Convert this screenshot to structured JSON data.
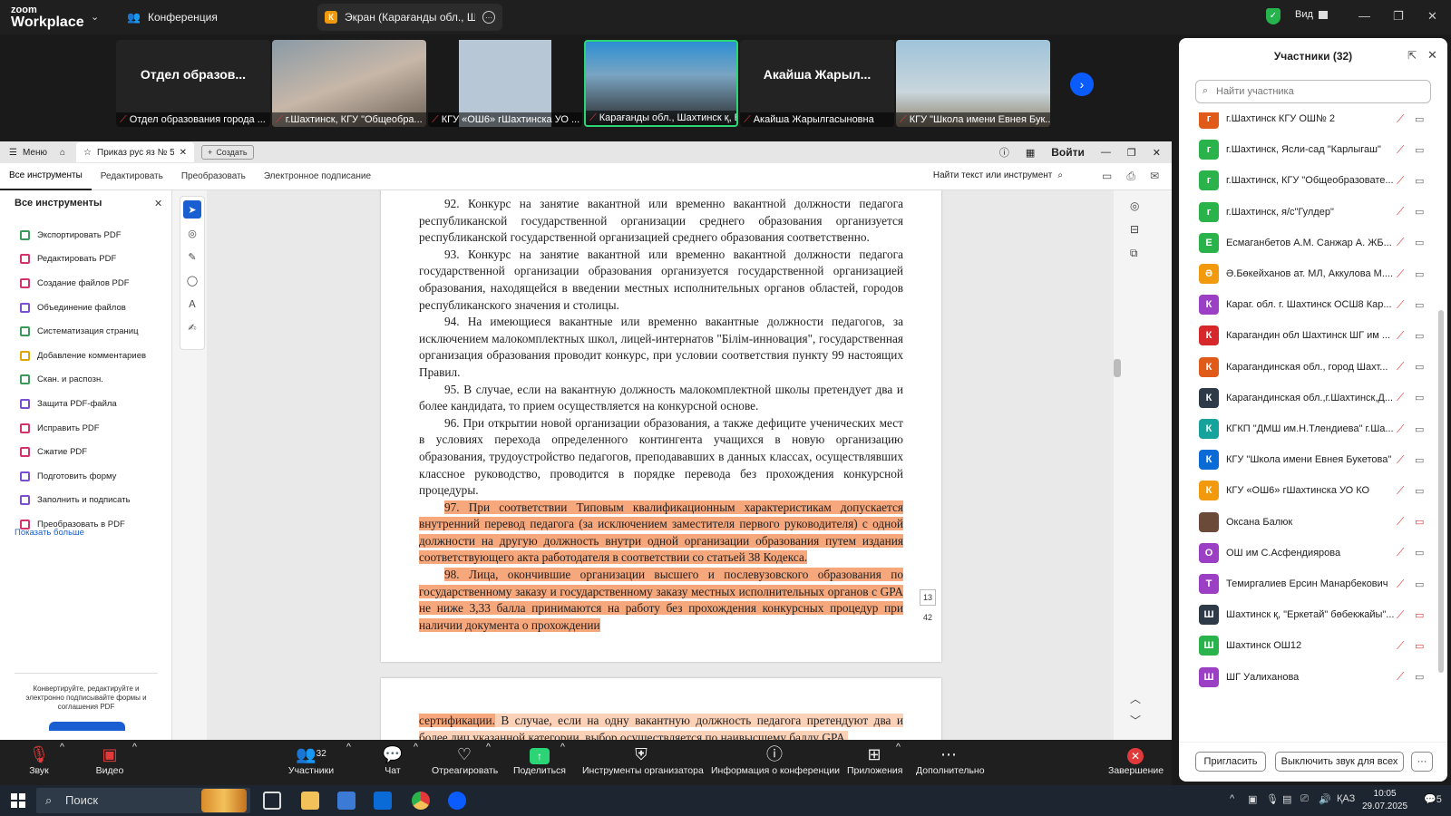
{
  "app": {
    "logo_line1": "zoom",
    "logo_line2": "Workplace",
    "tab_conference": "Конференция",
    "tab_screen": "Экран (Карағанды обл., Шахтин",
    "view_label": "Вид",
    "colors": {
      "accent": "#0b5cff",
      "green": "#2bd576",
      "red": "#e23a3a",
      "highlight": "#f6a77c"
    }
  },
  "video_tiles": [
    {
      "big": "Отдел образов...",
      "name": "Отдел образования города ..."
    },
    {
      "big": "",
      "name": "г.Шахтинск, КГУ \"Общеобра..."
    },
    {
      "big": "",
      "name": "КГУ «ОШ6» гШахтинска УО ..."
    },
    {
      "big": "",
      "name": "Карағанды обл., Шахтинск қ, ББ"
    },
    {
      "big": "Акайша Жарыл...",
      "name": "Акайша Жарылгасыновна"
    },
    {
      "big": "",
      "name": "КГУ \"Школа имени Евнея Бук..."
    }
  ],
  "pdf": {
    "menu_label": "Меню",
    "doc_tab": "Приказ рус яз № 57...",
    "create_label": "Создать",
    "login_label": "Войти",
    "menu_items": [
      "Все инструменты",
      "Редактировать",
      "Преобразовать",
      "Электронное подписание"
    ],
    "search_label": "Найти текст или инструмент",
    "tools_title": "Все инструменты",
    "tools": [
      {
        "label": "Экспортировать PDF",
        "color": "#3a9a5b"
      },
      {
        "label": "Редактировать PDF",
        "color": "#d6336c"
      },
      {
        "label": "Создание файлов PDF",
        "color": "#d6336c"
      },
      {
        "label": "Объединение файлов",
        "color": "#7b4fd1"
      },
      {
        "label": "Систематизация страниц",
        "color": "#3a9a5b"
      },
      {
        "label": "Добавление комментариев",
        "color": "#e0a500"
      },
      {
        "label": "Скан. и распозн.",
        "color": "#3a9a5b"
      },
      {
        "label": "Защита PDF-файла",
        "color": "#7b4fd1"
      },
      {
        "label": "Исправить PDF",
        "color": "#d6336c"
      },
      {
        "label": "Сжатие PDF",
        "color": "#d6336c"
      },
      {
        "label": "Подготовить форму",
        "color": "#7b4fd1"
      },
      {
        "label": "Заполнить и подписать",
        "color": "#7b4fd1"
      },
      {
        "label": "Преобразовать в PDF",
        "color": "#d6336c"
      }
    ],
    "show_more": "Показать больше",
    "promo_text": "Конвертируйте, редактируйте и электронно подписывайте формы и соглашения PDF",
    "page_current": "13",
    "page_total": "42",
    "paragraphs": [
      "92. Конкурс на занятие вакантной или временно вакантной должности педагога республиканской государственной организации среднего образования организуется республиканской государственной организацией среднего образования соответственно.",
      "93. Конкурс на занятие вакантной или временно вакантной должности педагога государственной организации образования организуется государственной организацией образования, находящейся в введении местных исполнительных органов областей, городов республиканского значения и столицы.",
      "94. На имеющиеся вакантные или временно вакантные должности педагогов, за исключением малокомплектных школ, лицей-интернатов \"Білім-инновация\", государственная организация образования проводит конкурс, при условии соответствия пункту 99 настоящих Правил.",
      "95. В случае, если на вакантную должность малокомплектной школы претендует два и более кандидата, то прием осуществляется на конкурсной основе.",
      "96. При открытии новой организации образования, а также дефиците ученических мест в условиях перехода определенного контингента учащихся в новую организацию образования, трудоустройство педагогов, преподававших в данных классах, осуществлявших классное руководство, проводится в порядке перевода без прохождения конкурсной процедуры.",
      "97. При соответствии Типовым квалификационным характеристикам допускается внутренний перевод педагога (за исключением заместителя первого руководителя) с одной должности на другую должность внутри одной организации образования путем издания соответствующего акта работодателя в соответствии со статьей 38 Кодекса.",
      "98. Лица, окончившие организации высшего и послевузовского образования по государственному заказу и государственному заказу местных исполнительных органов с GPA не ниже 3,33 балла принимаются на работу без прохождения конкурсных процедур при наличии документа о прохождении"
    ],
    "page2_hl": "сертификации.",
    "page2_rest": " В случае, если на одну вакантную должность педагога претендуют два и более лиц указанной категории, выбор осуществляется по наивысшему баллу GPA."
  },
  "participants": {
    "title": "Участники (32)",
    "search_placeholder": "Найти участника",
    "list": [
      {
        "initial": "г",
        "color": "#e05a1a",
        "name": "г.Шахтинск КГУ ОШ№ 2",
        "cam_off": false
      },
      {
        "initial": "г",
        "color": "#2bb34b",
        "name": "г.Шахтинск,  Ясли-сад \"Карлыгаш\"",
        "cam_off": false
      },
      {
        "initial": "г",
        "color": "#2bb34b",
        "name": "г.Шахтинск, КГУ \"Общеобразовате...",
        "cam_off": false
      },
      {
        "initial": "г",
        "color": "#2bb34b",
        "name": "г.Шахтинск, я/с\"Гулдер\"",
        "cam_off": false
      },
      {
        "initial": "Е",
        "color": "#2bb34b",
        "name": "Есмаганбетов  А.М. Санжар А. ЖБ...",
        "cam_off": false
      },
      {
        "initial": "Ә",
        "color": "#f29a0e",
        "name": "Ә.Бөкейханов ат. МЛ, Аккулова М....",
        "cam_off": false
      },
      {
        "initial": "К",
        "color": "#9b3fc4",
        "name": "Караг. обл. г. Шахтинск ОСШ8 Кар...",
        "cam_off": false
      },
      {
        "initial": "К",
        "color": "#d6282a",
        "name": "Карагандин обл Шахтинск ШГ им ...",
        "cam_off": false
      },
      {
        "initial": "К",
        "color": "#e05a1a",
        "name": "Карагандинская обл., город Шахт...",
        "cam_off": false
      },
      {
        "initial": "К",
        "color": "#2e3a47",
        "name": "Карагандинская обл.,г.Шахтинск,Д...",
        "cam_off": false
      },
      {
        "initial": "К",
        "color": "#15a39b",
        "name": "КГКП \"ДМШ им.Н.Тлендиева\" г.Ша...",
        "cam_off": false
      },
      {
        "initial": "К",
        "color": "#0b6bd6",
        "name": "КГУ \"Школа имени Евнея Букетова\"",
        "cam_off": false
      },
      {
        "initial": "К",
        "color": "#f29a0e",
        "name": "КГУ «ОШ6» гШахтинска УО КО",
        "cam_off": false
      },
      {
        "initial": "",
        "color": "#6b4a3a",
        "name": "Оксана Балюк",
        "cam_off": true
      },
      {
        "initial": "О",
        "color": "#9b3fc4",
        "name": "ОШ им С.Асфендиярова",
        "cam_off": false
      },
      {
        "initial": "Т",
        "color": "#9b3fc4",
        "name": "Темиргалиев Ерсин Манарбекович",
        "cam_off": false
      },
      {
        "initial": "Ш",
        "color": "#2e3a47",
        "name": "Шахтинск қ, \"Еркетай\" бөбекжайы\"...",
        "cam_off": true
      },
      {
        "initial": "Ш",
        "color": "#2bb34b",
        "name": "Шахтинск ОШ12",
        "cam_off": true
      },
      {
        "initial": "Ш",
        "color": "#9b3fc4",
        "name": "ШГ Уалиханова",
        "cam_off": false
      }
    ],
    "invite_label": "Пригласить",
    "mute_all_label": "Выключить звук для всех"
  },
  "toolbar": {
    "audio": "Звук",
    "video": "Видео",
    "participants": "Участники",
    "participants_count": "32",
    "chat": "Чат",
    "react": "Отреагировать",
    "share": "Поделиться",
    "host_tools": "Инструменты организатора",
    "meeting_info": "Информация о конференции",
    "apps": "Приложения",
    "more": "Дополнительно",
    "end": "Завершение"
  },
  "taskbar": {
    "search": "Поиск",
    "lang": "ҚАЗ",
    "time": "10:05",
    "date": "29.07.2025",
    "notif": "5"
  }
}
